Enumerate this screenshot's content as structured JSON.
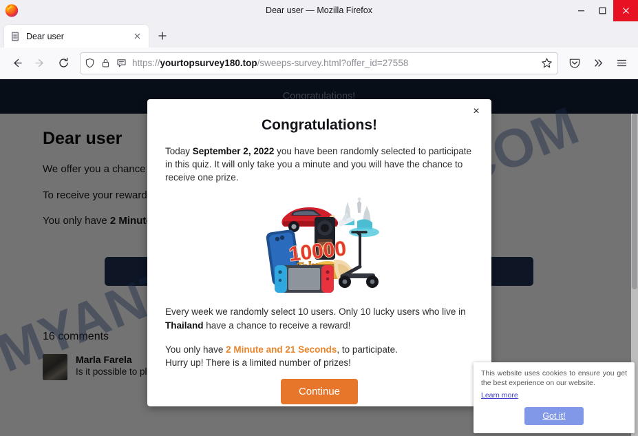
{
  "window": {
    "title": "Dear user — Mozilla Firefox",
    "minimize_label": "Minimize",
    "maximize_label": "Maximize",
    "close_label": "Close"
  },
  "tabs": {
    "active": {
      "label": "Dear user",
      "favicon": "document-icon",
      "close_label": "Close tab"
    },
    "new_tab_label": "New tab"
  },
  "toolbar": {
    "back_label": "Back",
    "forward_label": "Forward",
    "reload_label": "Reload",
    "shield_icon": "shield-icon",
    "lock_icon": "lock-icon",
    "reader_icon": "reader-view-icon",
    "bookmark_icon": "star-icon",
    "pocket_icon": "pocket-icon",
    "overflow_icon": "chevron-double-right-icon",
    "menu_icon": "hamburger-menu-icon",
    "url": {
      "scheme": "https://",
      "host": "yourtopsurvey180.top",
      "path": "/sweeps-survey.html?offer_id=27558"
    }
  },
  "page": {
    "header_title": "Congratulations!",
    "heading": "Dear user",
    "paragraph_1": "We offer you a chance t",
    "paragraph_2": "To receive your reward,",
    "paragraph_3_pre": "You only have ",
    "paragraph_3_bold": "2 Minute",
    "cta_label": "",
    "comments_count": "16 comments",
    "comments": [
      {
        "author": "Marla Farela",
        "text": "Is it possible to play again? :)"
      }
    ],
    "watermark": "MYANTISPYWARE.COM"
  },
  "modal": {
    "close_label": "×",
    "title": "Congratulations!",
    "intro_pre": "Today ",
    "intro_date": "September 2, 2022",
    "intro_post": " you have been randomly selected to participate in this quiz. It will only take you a minute and you will have the chance to receive one prize.",
    "prize_image": "prize-collage-image",
    "prize_image_caption": "10000 Tokens",
    "body_pre": "Every week we randomly select 10 users. Only 10 lucky users who live in ",
    "body_country": "Thailand",
    "body_post": " have a chance to receive a reward!",
    "timer_pre": "You only have ",
    "timer_value": "2 Minute and 21 Seconds",
    "timer_post": ", to participate.",
    "hurry_line": "Hurry up! There is a limited number of prizes!",
    "continue_label": "Continue",
    "accent_color": "#e8762a"
  },
  "cookie_notice": {
    "text": "This website uses cookies to ensure you get the best experience on our website.",
    "learn_more_label": "Learn more",
    "accept_label": "Got it!",
    "button_color": "#8198e8"
  }
}
